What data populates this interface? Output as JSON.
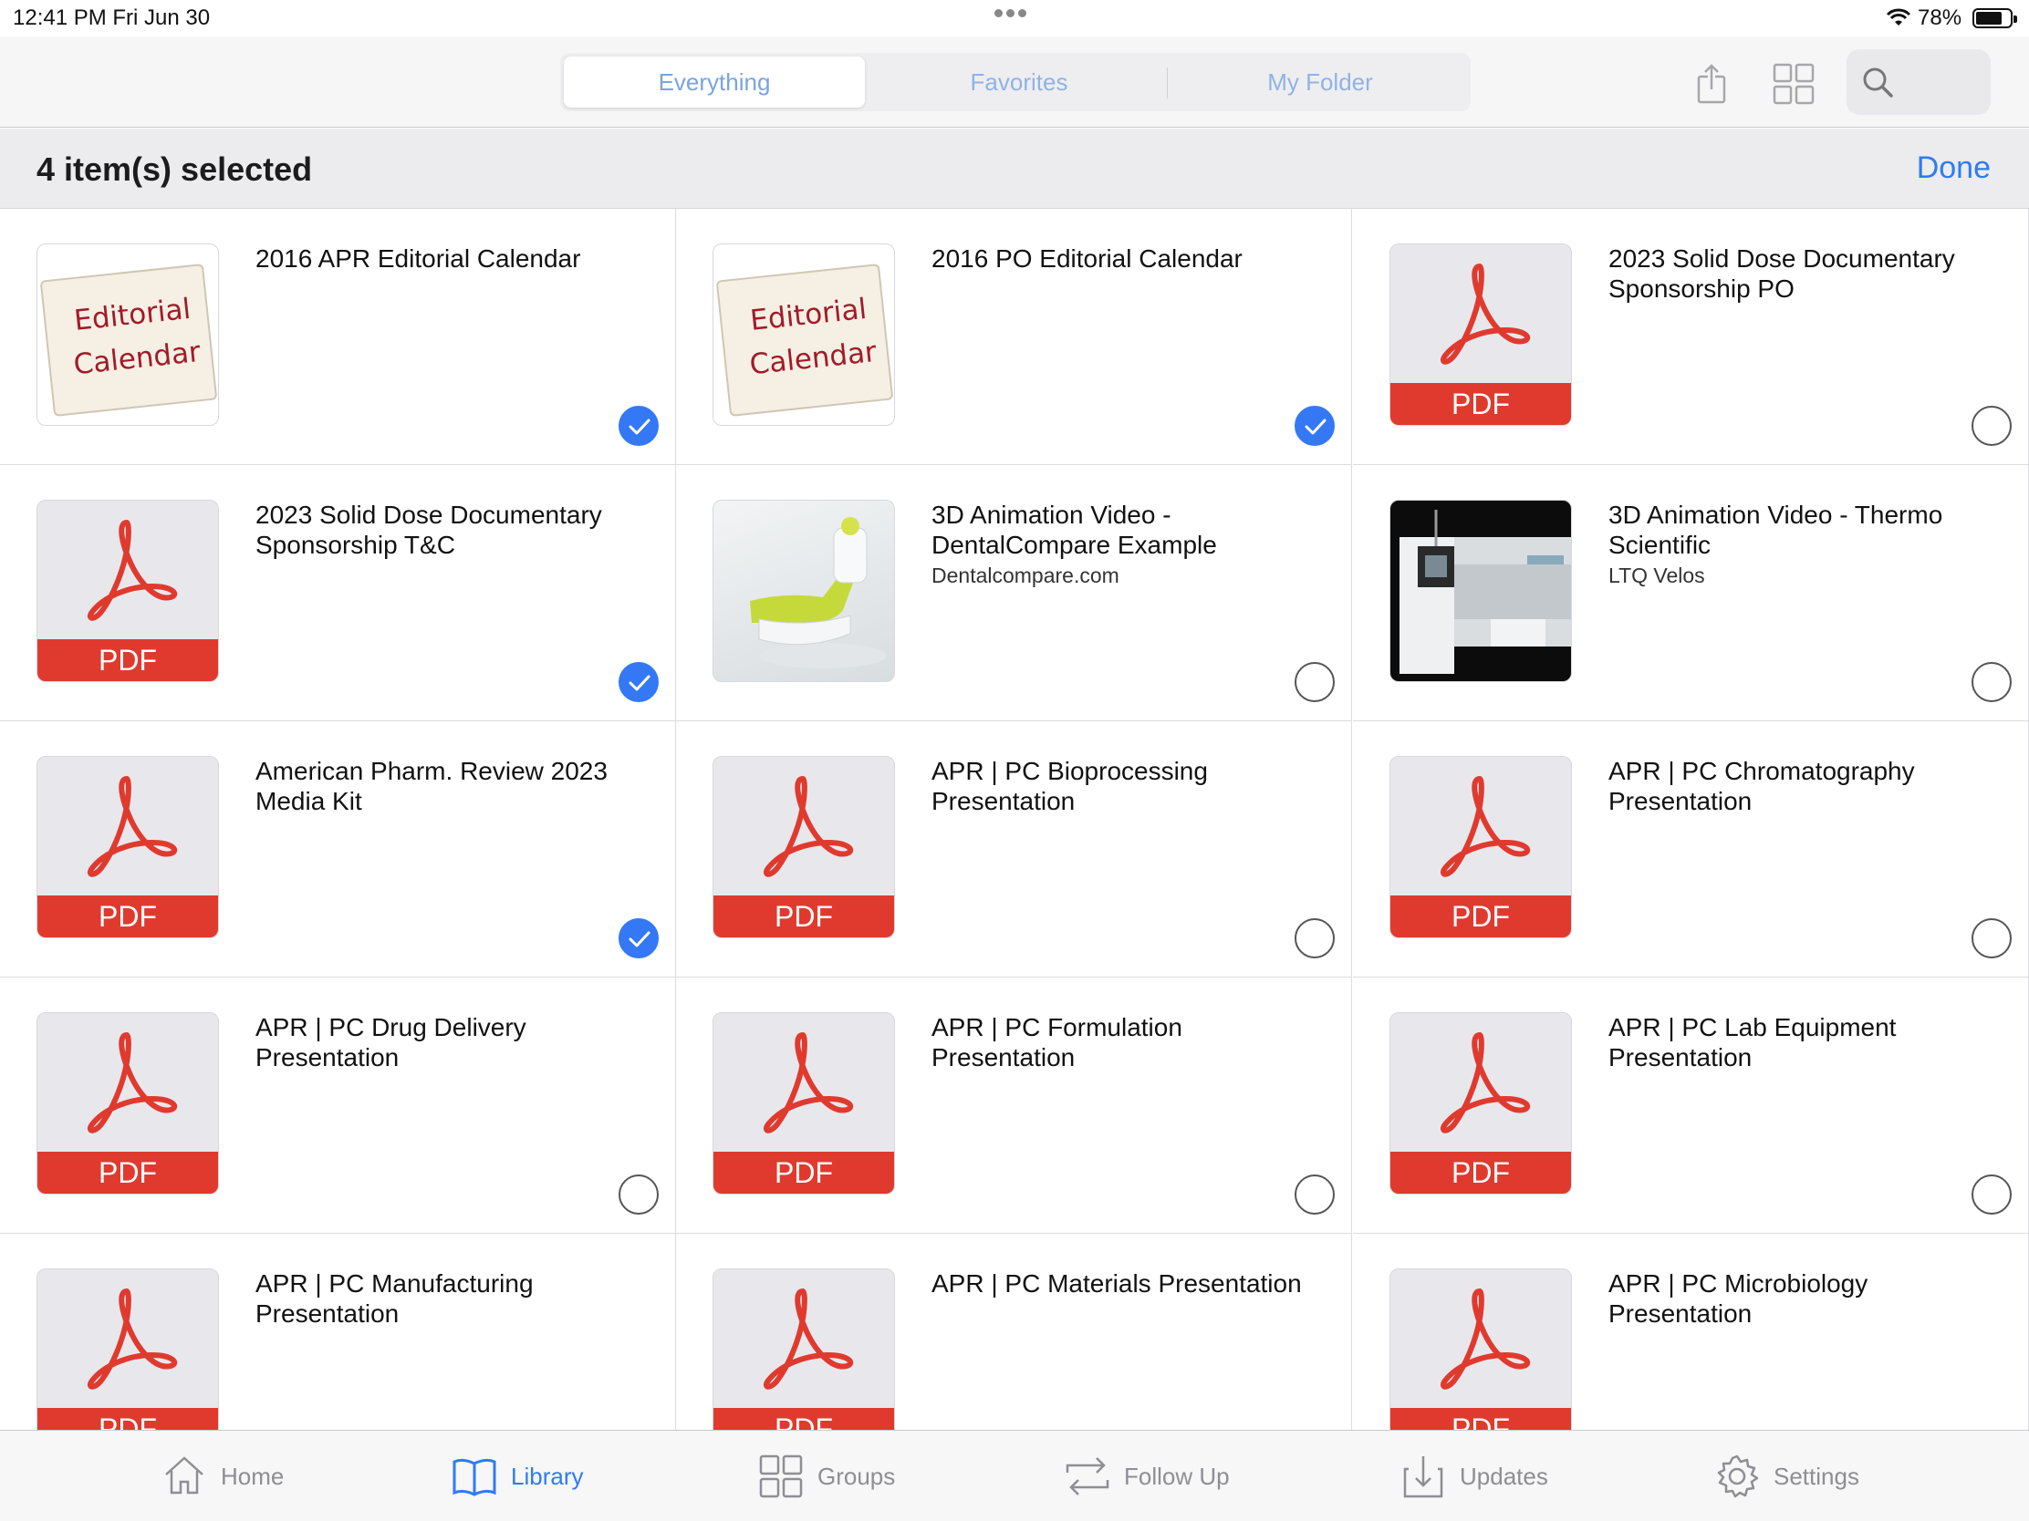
{
  "status": {
    "time": "12:41 PM   Fri Jun 30",
    "battery": "78%",
    "battery_level": 0.78
  },
  "nav": {
    "segments": [
      "Everything",
      "Favorites",
      "My Folder"
    ],
    "active_segment": 0
  },
  "selection": {
    "title": "4 item(s) selected",
    "done_label": "Done"
  },
  "items": [
    {
      "title": "2016 APR Editorial Calendar",
      "subtitle": "",
      "thumb": "calendar",
      "thumb_text": [
        "Editorial",
        "Calendar"
      ],
      "selected": true
    },
    {
      "title": "2016 PO Editorial Calendar",
      "subtitle": "",
      "thumb": "calendar",
      "thumb_text": [
        "Editorial",
        "Calendar"
      ],
      "selected": true
    },
    {
      "title": "2023 Solid Dose Documentary Sponsorship PO",
      "subtitle": "",
      "thumb": "pdf",
      "thumb_text": [
        "PDF"
      ],
      "selected": false
    },
    {
      "title": "2023 Solid Dose Documentary Sponsorship T&C",
      "subtitle": "",
      "thumb": "pdf",
      "thumb_text": [
        "PDF"
      ],
      "selected": true
    },
    {
      "title": "3D Animation Video - DentalCompare Example",
      "subtitle": "Dentalcompare.com",
      "thumb": "dental",
      "thumb_text": [],
      "selected": false
    },
    {
      "title": "3D Animation Video - Thermo Scientific",
      "subtitle": "LTQ Velos",
      "thumb": "thermo",
      "thumb_text": [],
      "selected": false
    },
    {
      "title": "American Pharm. Review 2023 Media Kit",
      "subtitle": "",
      "thumb": "pdf",
      "thumb_text": [
        "PDF"
      ],
      "selected": true
    },
    {
      "title": "APR | PC Bioprocessing Presentation",
      "subtitle": "",
      "thumb": "pdf",
      "thumb_text": [
        "PDF"
      ],
      "selected": false
    },
    {
      "title": "APR | PC Chromatography Presentation",
      "subtitle": "",
      "thumb": "pdf",
      "thumb_text": [
        "PDF"
      ],
      "selected": false
    },
    {
      "title": "APR | PC Drug Delivery Presentation",
      "subtitle": "",
      "thumb": "pdf",
      "thumb_text": [
        "PDF"
      ],
      "selected": false
    },
    {
      "title": "APR | PC Formulation Presentation",
      "subtitle": "",
      "thumb": "pdf",
      "thumb_text": [
        "PDF"
      ],
      "selected": false
    },
    {
      "title": "APR | PC Lab Equipment Presentation",
      "subtitle": "",
      "thumb": "pdf",
      "thumb_text": [
        "PDF"
      ],
      "selected": false
    },
    {
      "title": "APR | PC Manufacturing Presentation",
      "subtitle": "",
      "thumb": "pdf",
      "thumb_text": [
        "PDF"
      ],
      "selected": false
    },
    {
      "title": "APR | PC Materials Presentation",
      "subtitle": "",
      "thumb": "pdf",
      "thumb_text": [
        "PDF"
      ],
      "selected": false
    },
    {
      "title": "APR | PC Microbiology Presentation",
      "subtitle": "",
      "thumb": "pdf",
      "thumb_text": [
        "PDF"
      ],
      "selected": false
    }
  ],
  "tabs": [
    {
      "label": "Home",
      "icon": "home-icon"
    },
    {
      "label": "Library",
      "icon": "book-icon"
    },
    {
      "label": "Groups",
      "icon": "groups-icon"
    },
    {
      "label": "Follow Up",
      "icon": "repeat-icon"
    },
    {
      "label": "Updates",
      "icon": "download-icon"
    },
    {
      "label": "Settings",
      "icon": "gear-icon"
    }
  ],
  "active_tab": 1,
  "colors": {
    "accent": "#2f7bf5",
    "pdf_red": "#e03a2f",
    "check_blue": "#3478f6"
  }
}
